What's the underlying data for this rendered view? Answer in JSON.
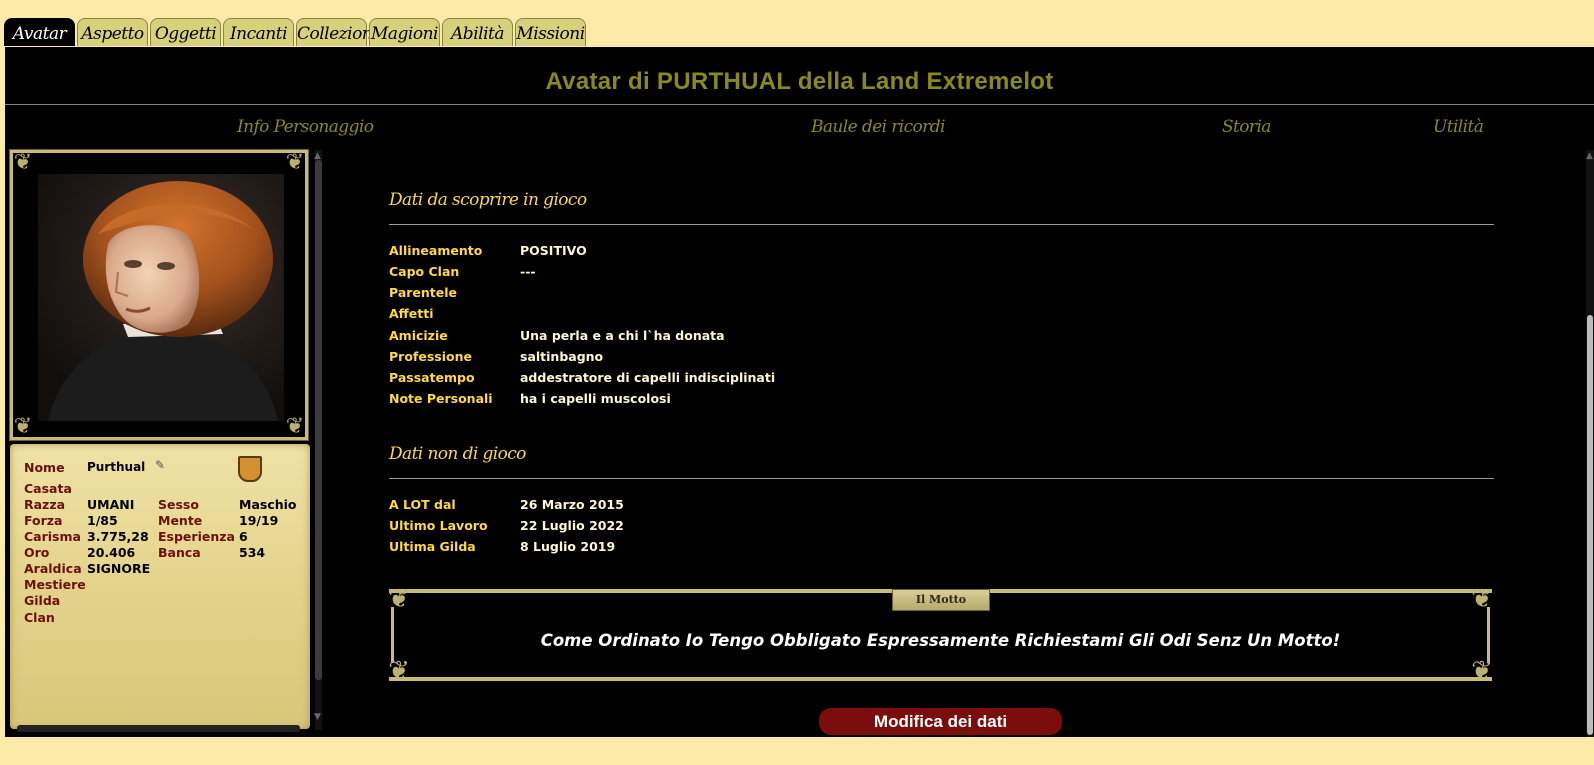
{
  "tabs": [
    "Avatar",
    "Aspetto",
    "Oggetti",
    "Incanti",
    "Collezioni",
    "Magioni",
    "Abilità",
    "Missioni"
  ],
  "header": {
    "title": "Avatar di PURTHUAL della Land Extremelot"
  },
  "subnav": [
    "Info Personaggio",
    "Baule dei ricordi",
    "Storia",
    "Utilità"
  ],
  "profile": {
    "rows": [
      {
        "label": "Nome",
        "value": "Purthual"
      },
      {
        "label": "Casata",
        "value": ""
      },
      {
        "label": "Razza",
        "value": "UMANI",
        "label2": "Sesso",
        "value2": "Maschio"
      },
      {
        "label": "Forza",
        "value": "1/85",
        "label2": "Mente",
        "value2": "19/19"
      },
      {
        "label": "Carisma",
        "value": "3.775,28",
        "label2": "Esperienza",
        "value2": "6"
      },
      {
        "label": "Oro",
        "value": "20.406",
        "label2": "Banca",
        "value2": "534"
      },
      {
        "label": "Araldica",
        "value": "SIGNORE"
      },
      {
        "label": "Mestiere",
        "value": ""
      },
      {
        "label": "Gilda",
        "value": ""
      },
      {
        "label": "Clan",
        "value": ""
      }
    ]
  },
  "game_data": {
    "title": "Dati da scoprire in gioco",
    "rows": [
      {
        "key": "Allineamento",
        "value": "POSITIVO"
      },
      {
        "key": "Capo Clan",
        "value": "---"
      },
      {
        "key": "Parentele",
        "value": ""
      },
      {
        "key": "Affetti",
        "value": ""
      },
      {
        "key": "Amicizie",
        "value": "Una perla e a chi l`ha donata"
      },
      {
        "key": "Professione",
        "value": "saltinbagno"
      },
      {
        "key": "Passatempo",
        "value": "addestratore di capelli indisciplinati"
      },
      {
        "key": "Note Personali",
        "value": "ha i capelli muscolosi"
      }
    ]
  },
  "offgame_data": {
    "title": "Dati non di gioco",
    "rows": [
      {
        "key": "A LOT dal",
        "value": "26 Marzo 2015"
      },
      {
        "key": "Ultimo Lavoro",
        "value": "22 Luglio 2022"
      },
      {
        "key": "Ultima Gilda",
        "value": "8 Luglio 2019"
      }
    ]
  },
  "motto": {
    "badge": "Il Motto",
    "text": "Come Ordinato Io Tengo Obbligato Espressamente Richiestami Gli Odi Senz Un Motto!"
  },
  "edit_button": "Modifica dei dati"
}
